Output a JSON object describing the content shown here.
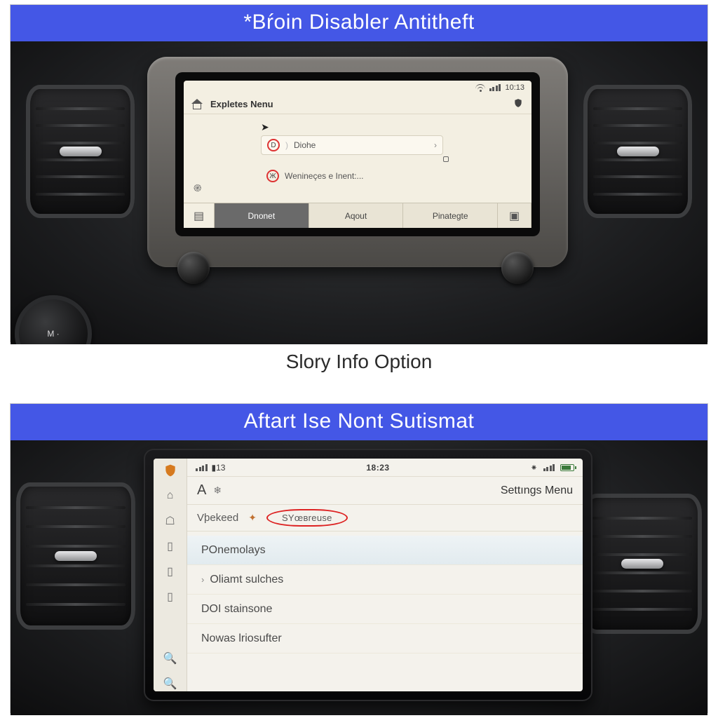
{
  "top": {
    "banner": "*Bŕoin Disabler Antitheft",
    "screen": {
      "status_time": "10:13",
      "header_title": "Expletes Nenu",
      "option1": {
        "badge": "D",
        "label": "Diohe"
      },
      "option2": {
        "badge": "Ж",
        "label": "Wenineçes e Inent:..."
      },
      "side_glyph": "֎",
      "tabs": {
        "icon_left": "▤",
        "t1": "Dnonet",
        "t2": "Aqout",
        "t3": "Pinategte",
        "icon_right": "▣"
      }
    }
  },
  "mid_caption": "Slory Info Option",
  "bottom": {
    "banner": "Aftart Ise Nont Sutismat",
    "screen": {
      "status": {
        "left_num": "13",
        "clock": "18:23"
      },
      "header": {
        "letter": "A",
        "title": "Settıngs Menu"
      },
      "subheader": {
        "left_label": "Vþekeed",
        "circled": "SYœвreuse"
      },
      "list": {
        "r1": "POnemolays",
        "r2": "Oliamt sulches",
        "r3": "DOI stainsone",
        "r4": "Nowas lriosufter"
      }
    }
  },
  "aux": {
    "dial_marks": "M\n·"
  }
}
